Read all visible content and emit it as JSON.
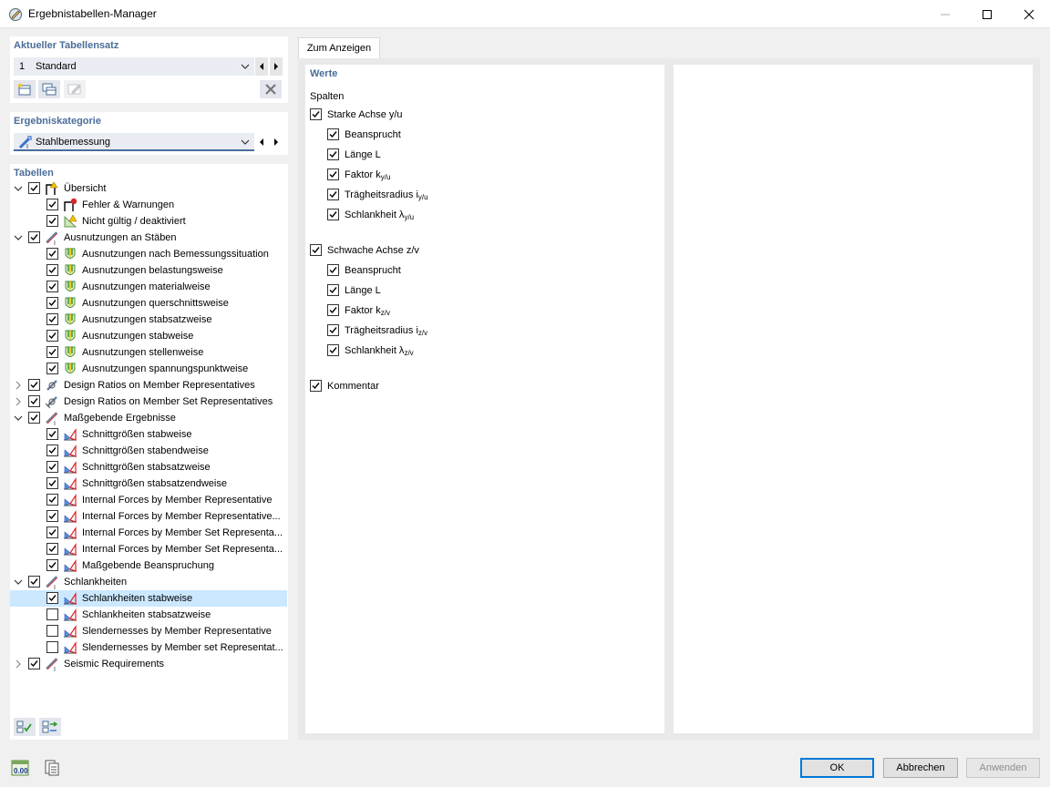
{
  "window": {
    "title": "Ergebnistabellen-Manager"
  },
  "current_set": {
    "heading": "Aktueller Tabellensatz",
    "number": "1",
    "value": "Standard"
  },
  "category": {
    "heading": "Ergebniskategorie",
    "value": "Stahlbemessung"
  },
  "tables": {
    "heading": "Tabellen",
    "items": [
      {
        "label": "Übersicht",
        "level": 0,
        "checked": true,
        "expanded": true,
        "icon": "overview-icon"
      },
      {
        "label": "Fehler & Warnungen",
        "level": 1,
        "checked": true,
        "icon": "errors-icon"
      },
      {
        "label": "Nicht gültig / deaktiviert",
        "level": 1,
        "checked": true,
        "icon": "invalid-icon"
      },
      {
        "label": "Ausnutzungen an Stäben",
        "level": 0,
        "checked": true,
        "expanded": true,
        "icon": "member-icon"
      },
      {
        "label": "Ausnutzungen nach Bemessungssituation",
        "level": 1,
        "checked": true,
        "icon": "utilization-icon"
      },
      {
        "label": "Ausnutzungen belastungsweise",
        "level": 1,
        "checked": true,
        "icon": "utilization-icon"
      },
      {
        "label": "Ausnutzungen materialweise",
        "level": 1,
        "checked": true,
        "icon": "utilization-icon"
      },
      {
        "label": "Ausnutzungen querschnittsweise",
        "level": 1,
        "checked": true,
        "icon": "utilization-icon"
      },
      {
        "label": "Ausnutzungen stabsatzweise",
        "level": 1,
        "checked": true,
        "icon": "utilization-icon"
      },
      {
        "label": "Ausnutzungen stabweise",
        "level": 1,
        "checked": true,
        "icon": "utilization-icon"
      },
      {
        "label": "Ausnutzungen stellenweise",
        "level": 1,
        "checked": true,
        "icon": "utilization-icon"
      },
      {
        "label": "Ausnutzungen spannungspunktweise",
        "level": 1,
        "checked": true,
        "icon": "utilization-icon"
      },
      {
        "label": "Design Ratios on Member Representatives",
        "level": 0,
        "checked": true,
        "expanded": false,
        "icon": "member-rep-icon"
      },
      {
        "label": "Design Ratios on Member Set Representatives",
        "level": 0,
        "checked": true,
        "expanded": false,
        "icon": "member-set-rep-icon"
      },
      {
        "label": "Maßgebende Ergebnisse",
        "level": 0,
        "checked": true,
        "expanded": true,
        "icon": "member-icon"
      },
      {
        "label": "Schnittgrößen stabweise",
        "level": 1,
        "checked": true,
        "icon": "internal-forces-icon"
      },
      {
        "label": "Schnittgrößen stabendweise",
        "level": 1,
        "checked": true,
        "icon": "internal-forces-icon"
      },
      {
        "label": "Schnittgrößen stabsatzweise",
        "level": 1,
        "checked": true,
        "icon": "internal-forces-icon"
      },
      {
        "label": "Schnittgrößen stabsatzendweise",
        "level": 1,
        "checked": true,
        "icon": "internal-forces-icon"
      },
      {
        "label": "Internal Forces by Member Representative",
        "level": 1,
        "checked": true,
        "icon": "internal-forces-icon"
      },
      {
        "label": "Internal Forces by Member Representative...",
        "level": 1,
        "checked": true,
        "icon": "internal-forces-icon"
      },
      {
        "label": "Internal Forces by Member Set Representa...",
        "level": 1,
        "checked": true,
        "icon": "internal-forces-icon"
      },
      {
        "label": "Internal Forces by Member Set Representa...",
        "level": 1,
        "checked": true,
        "icon": "internal-forces-icon"
      },
      {
        "label": "Maßgebende Beanspruchung",
        "level": 1,
        "checked": true,
        "icon": "internal-forces-icon"
      },
      {
        "label": "Schlankheiten",
        "level": 0,
        "checked": true,
        "expanded": true,
        "icon": "member-icon"
      },
      {
        "label": "Schlankheiten stabweise",
        "level": 1,
        "checked": true,
        "icon": "internal-forces-icon",
        "selected": true
      },
      {
        "label": "Schlankheiten stabsatzweise",
        "level": 1,
        "checked": false,
        "icon": "internal-forces-icon"
      },
      {
        "label": "Slendernesses by Member Representative",
        "level": 1,
        "checked": false,
        "icon": "internal-forces-icon"
      },
      {
        "label": "Slendernesses by Member set Representat...",
        "level": 1,
        "checked": false,
        "icon": "internal-forces-icon"
      },
      {
        "label": "Seismic Requirements",
        "level": 0,
        "checked": true,
        "expanded": false,
        "icon": "member-icon"
      }
    ]
  },
  "tab": {
    "label": "Zum Anzeigen"
  },
  "values": {
    "heading": "Werte",
    "columns_label": "Spalten",
    "strong_axis": {
      "label": "Starke Achse y/u",
      "checked": true,
      "items": [
        {
          "text": "Beansprucht",
          "sub": "",
          "checked": true
        },
        {
          "text": "Länge L",
          "sub": "",
          "checked": true
        },
        {
          "text": "Faktor k",
          "sub": "y/u",
          "checked": true
        },
        {
          "text": "Trägheitsradius i",
          "sub": "y/u",
          "checked": true
        },
        {
          "text": "Schlankheit λ",
          "sub": "y/u",
          "checked": true
        }
      ]
    },
    "weak_axis": {
      "label": "Schwache Achse z/v",
      "checked": true,
      "items": [
        {
          "text": "Beansprucht",
          "sub": "",
          "checked": true
        },
        {
          "text": "Länge L",
          "sub": "",
          "checked": true
        },
        {
          "text": "Faktor k",
          "sub": "z/v",
          "checked": true
        },
        {
          "text": "Trägheitsradius i",
          "sub": "z/v",
          "checked": true
        },
        {
          "text": "Schlankheit λ",
          "sub": "z/v",
          "checked": true
        }
      ]
    },
    "comment": {
      "label": "Kommentar",
      "checked": true
    }
  },
  "buttons": {
    "ok": "OK",
    "cancel": "Abbrechen",
    "apply": "Anwenden"
  },
  "colors": {
    "accent": "#0078d7",
    "heading": "#4a6d9a",
    "selection": "#cce8ff"
  }
}
